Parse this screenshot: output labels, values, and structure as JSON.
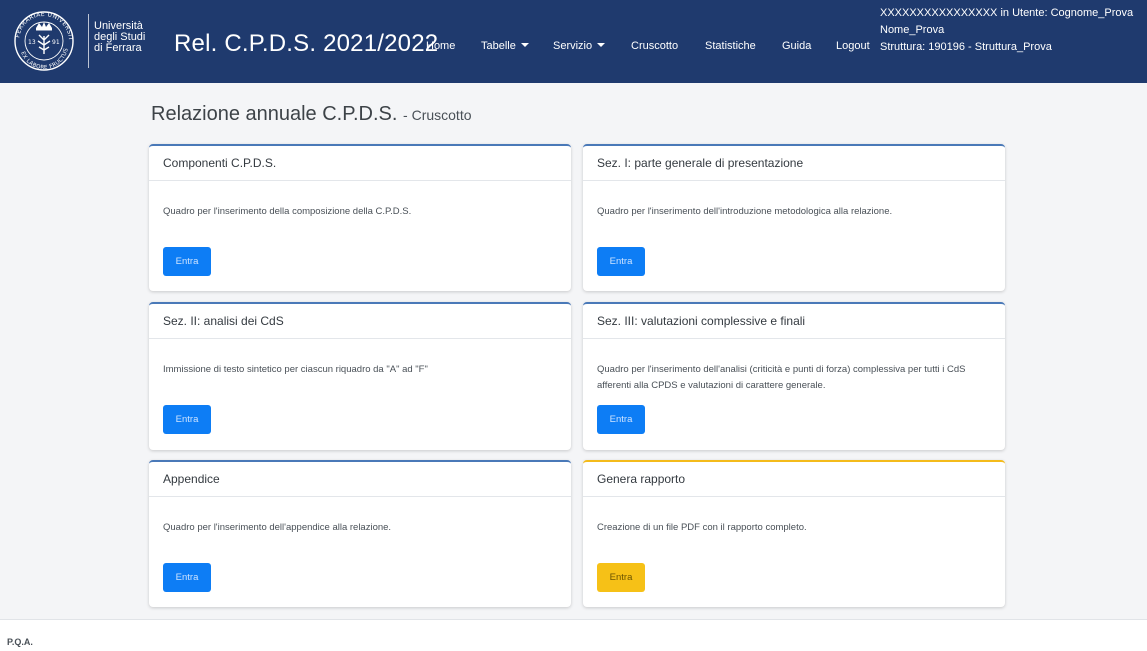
{
  "logo": {
    "line1": "Università",
    "line2": "degli Studi",
    "line3": "di Ferrara",
    "seal_text_top": "FERRARIAE UNIVERSITAS",
    "seal_text_bottom": "EX LABORE FRUCTUS",
    "seal_left_digits": "13",
    "seal_right_digits": "91"
  },
  "navbar": {
    "brand": "Rel. C.P.D.S. 2021/2022",
    "links": {
      "home": "Home",
      "tabelle": "Tabelle",
      "servizio": "Servizio",
      "cruscotto": "Cruscotto",
      "statistiche": "Statistiche",
      "guida": "Guida",
      "logout": "Logout"
    },
    "user": {
      "line1": "XXXXXXXXXXXXXXXX in Utente: Cognome_Prova",
      "line2": "Nome_Prova",
      "line3": "Struttura: 190196 - Struttura_Prova"
    }
  },
  "heading": {
    "title": "Relazione annuale C.P.D.S.",
    "subtitle": "- Cruscotto"
  },
  "cards": [
    {
      "header": "Componenti C.P.D.S.",
      "text": "Quadro per l'inserimento della composizione della C.P.D.S.",
      "button": "Entra"
    },
    {
      "header": "Sez. I: parte generale di presentazione",
      "text": "Quadro per l'inserimento dell'introduzione metodologica alla relazione.",
      "button": "Entra"
    },
    {
      "header": "Sez. II: analisi dei CdS",
      "text": "Immissione di testo sintetico per ciascun riquadro da \"A\" ad \"F\"",
      "button": "Entra"
    },
    {
      "header": "Sez. III: valutazioni complessive e finali",
      "text": "Quadro per l'inserimento dell'analisi (criticità e punti di forza) complessiva per tutti i CdS afferenti alla CPDS e valutazioni di carattere generale.",
      "button": "Entra"
    },
    {
      "header": "Appendice",
      "text": "Quadro per l'inserimento dell'appendice alla relazione.",
      "button": "Entra"
    },
    {
      "header": "Genera rapporto",
      "text": "Creazione di un file PDF con il rapporto completo.",
      "button": "Entra"
    }
  ],
  "footer": {
    "text": "P.Q.A."
  },
  "colors": {
    "navbar": "#1f3a6e",
    "primary_button": "#0d7df5",
    "warning_button": "#f6c117",
    "card_accent": "#4a79b8",
    "warning_accent": "#f4bb1b"
  }
}
